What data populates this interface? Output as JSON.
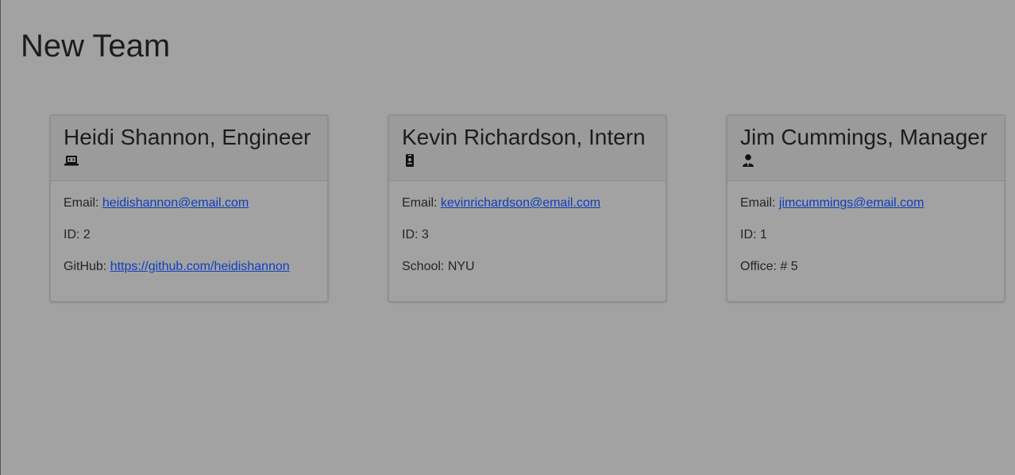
{
  "page": {
    "title": "New Team"
  },
  "cards": [
    {
      "title": "Heidi Shannon, Engineer",
      "icon": "laptop-code-icon",
      "email_label": "Email:",
      "email": "heidishannon@email.com",
      "id_text": "ID: 2",
      "extra_label": "GitHub:",
      "extra_link": "https://github.com/heidishannon"
    },
    {
      "title": "Kevin Richardson, Intern",
      "icon": "id-badge-icon",
      "email_label": "Email:",
      "email": "kevinrichardson@email.com",
      "id_text": "ID: 3",
      "extra_text": "School: NYU"
    },
    {
      "title": "Jim Cummings, Manager",
      "icon": "user-tie-icon",
      "email_label": "Email:",
      "email": "jimcummings@email.com",
      "id_text": "ID: 1",
      "extra_text": "Office: # 5"
    }
  ],
  "colors": {
    "background": "#a2a2a2",
    "link": "#0d3fbf",
    "text": "#212529"
  }
}
